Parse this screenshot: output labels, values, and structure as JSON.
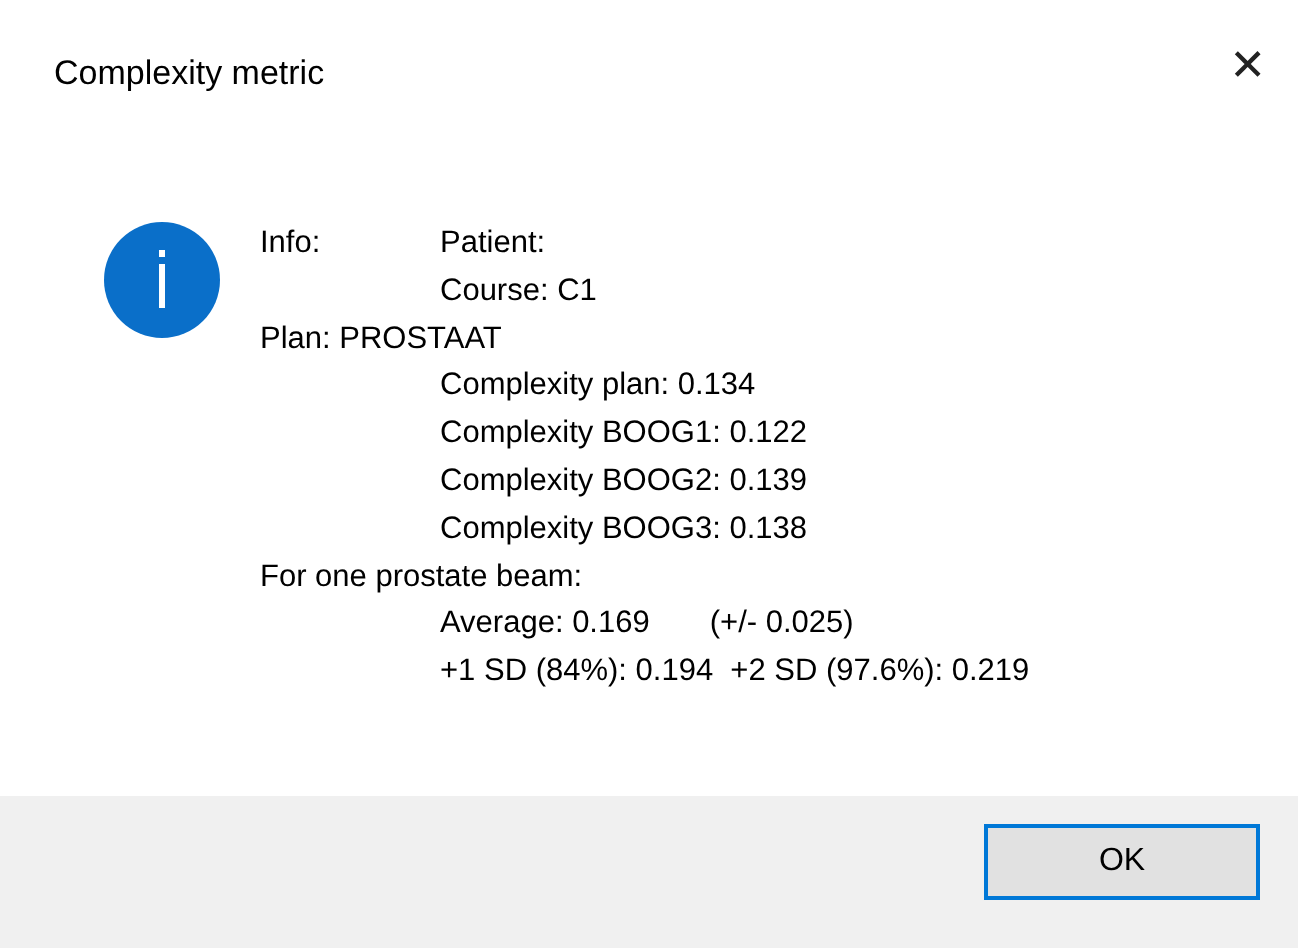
{
  "window": {
    "title": "Complexity metric",
    "close": "✕"
  },
  "message": {
    "lines": [
      {
        "kind": "labeled",
        "texts": [
          "Info:",
          "Patient:"
        ]
      },
      {
        "kind": "indent",
        "texts": [
          "Course: C1"
        ]
      },
      {
        "kind": "full",
        "texts": [
          "Plan: PROSTAAT"
        ]
      },
      {
        "kind": "indent",
        "texts": [
          "Complexity plan: 0.134"
        ]
      },
      {
        "kind": "indent",
        "texts": [
          "Complexity BOOG1: 0.122"
        ]
      },
      {
        "kind": "indent",
        "texts": [
          "Complexity BOOG2: 0.139"
        ]
      },
      {
        "kind": "indent",
        "texts": [
          "Complexity BOOG3: 0.138"
        ]
      },
      {
        "kind": "full",
        "texts": [
          "For one prostate beam:"
        ]
      },
      {
        "kind": "indent",
        "texts": [
          "Average: 0.169",
          "(+/- 0.025)"
        ]
      },
      {
        "kind": "indent",
        "texts": [
          "+1 SD (84%): 0.194  +2 SD (97.6%): 0.219"
        ]
      }
    ]
  },
  "buttons": [
    {
      "label": "OK",
      "default": true
    }
  ]
}
